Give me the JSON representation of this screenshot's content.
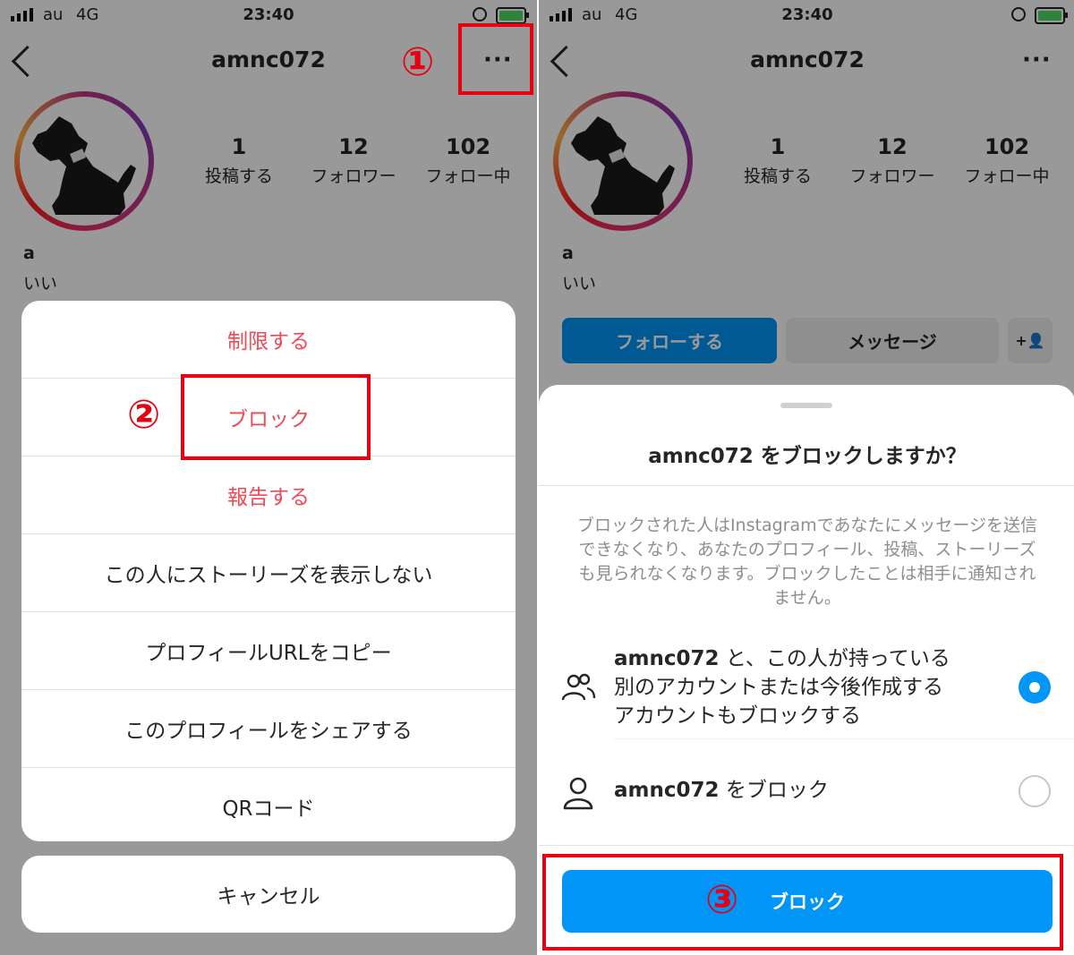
{
  "status_bar": {
    "carrier": "au",
    "network": "4G",
    "time": "23:40"
  },
  "profile": {
    "username": "amnc072",
    "posts_count": "1",
    "posts_label": "投稿する",
    "followers_count": "12",
    "followers_label": "フォロワー",
    "following_count": "102",
    "following_label": "フォロー中",
    "name": "a",
    "bio": "いい",
    "more_glyph": "···"
  },
  "action_sheet": {
    "items": [
      "制限する",
      "ブロック",
      "報告する",
      "この人にストーリーズを表示しない",
      "プロフィールURLをコピー",
      "このプロフィールをシェアする",
      "QRコード"
    ],
    "cancel": "キャンセル"
  },
  "buttons": {
    "follow": "フォローする",
    "message": "メッセージ",
    "add_person_glyph": "+👤"
  },
  "block_dialog": {
    "title": "amnc072 をブロックしますか？",
    "description": "ブロックされた人はInstagramであなたにメッセージを送信できなくなり、あなたのプロフィール、投稿、ストーリーズも見られなくなります。ブロックしたことは相手に通知されません。",
    "option1_user": "amnc072",
    "option1_rest": "と、この人が持っている別のアカウントまたは今後作成するアカウントもブロックする",
    "option1_selected": true,
    "option2_user": "amnc072",
    "option2_rest": "をブロック",
    "option2_selected": false,
    "block_button": "ブロック"
  },
  "annotations": {
    "step1": "①",
    "step2": "②",
    "step3": "③"
  },
  "colors": {
    "accent": "#0095f6",
    "destructive": "#ed4956",
    "annotation": "#e60012"
  }
}
